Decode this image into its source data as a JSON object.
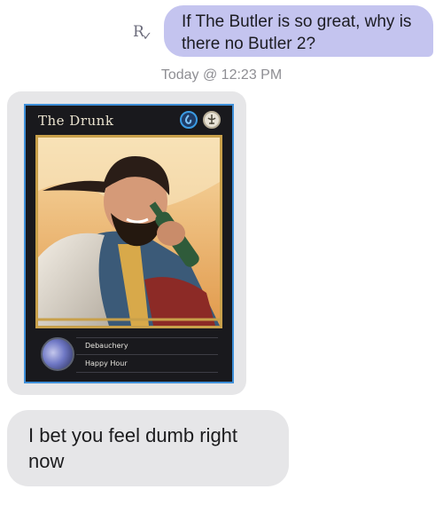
{
  "messages": {
    "outgoing": {
      "text": "If The Butler is so great, why is there no Butler 2?",
      "read_receipt": "R"
    },
    "timestamp": "Today @ 12:23 PM",
    "image_card": {
      "title": "The Drunk",
      "faction_icons": [
        "water-icon",
        "spirit-icon"
      ],
      "abilities": [
        "Debauchery",
        "Happy Hour"
      ],
      "border_color": "#3e8fd8",
      "frame_color": "#c8a04a"
    },
    "incoming": {
      "text": "I bet you feel dumb right now"
    }
  },
  "colors": {
    "outgoing_bubble": "#c4c4ef",
    "incoming_bubble": "#e6e6e8"
  }
}
